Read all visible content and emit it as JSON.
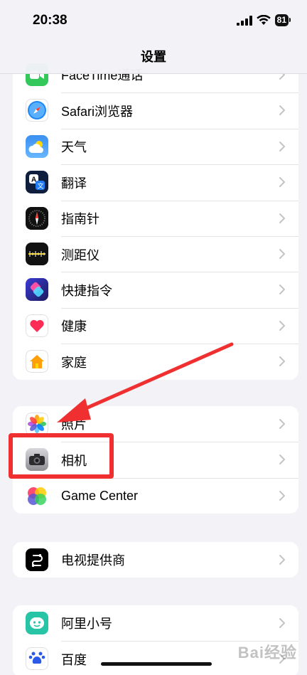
{
  "status_bar": {
    "time": "20:38",
    "battery": "81"
  },
  "nav": {
    "title": "设置"
  },
  "groups": [
    {
      "items": [
        {
          "label": "FaceTime通话",
          "icon": "facetime-icon",
          "color": "#34c759"
        },
        {
          "label": "Safari浏览器",
          "icon": "safari-icon",
          "color": "#1e88f5"
        },
        {
          "label": "天气",
          "icon": "weather-icon",
          "color": "#2f8ff0"
        },
        {
          "label": "翻译",
          "icon": "translate-icon",
          "color": "#0f1e3d"
        },
        {
          "label": "指南针",
          "icon": "compass-icon",
          "color": "#111111"
        },
        {
          "label": "测距仪",
          "icon": "measure-icon",
          "color": "#111111"
        },
        {
          "label": "快捷指令",
          "icon": "shortcuts-icon",
          "color": "#5b3df5"
        },
        {
          "label": "健康",
          "icon": "health-icon",
          "color": "#ff2d55"
        },
        {
          "label": "家庭",
          "icon": "home-icon",
          "color": "#ff9f0a"
        }
      ]
    },
    {
      "items": [
        {
          "label": "照片",
          "icon": "photos-icon",
          "color": "#ffffff"
        },
        {
          "label": "相机",
          "icon": "camera-icon",
          "color": "#8e8e93"
        },
        {
          "label": "Game Center",
          "icon": "game-center-icon",
          "color": "#ffffff"
        }
      ]
    },
    {
      "items": [
        {
          "label": "电视提供商",
          "icon": "tv-provider-icon",
          "color": "#000000"
        }
      ]
    },
    {
      "items": [
        {
          "label": "阿里小号",
          "icon": "ali-xiaohao-icon",
          "color": "#27c4a6"
        },
        {
          "label": "百度",
          "icon": "baidu-icon",
          "color": "#2b5ae8"
        }
      ]
    }
  ],
  "annotation": {
    "highlight_color": "#f03030"
  },
  "watermark": "Bai经验"
}
